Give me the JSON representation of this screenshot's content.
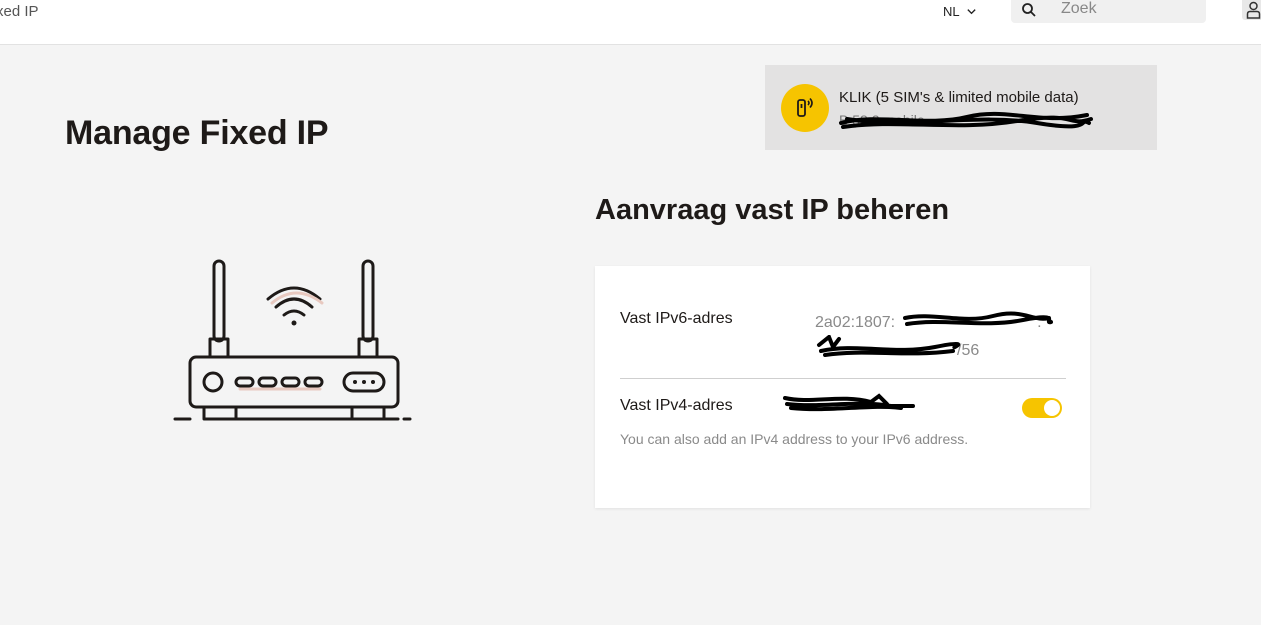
{
  "header": {
    "breadcrumb": "xed IP",
    "language": "NL",
    "search_placeholder": "Zoek"
  },
  "subscription": {
    "title": "KLIK (5 SIM's & limited mobile data)",
    "number_visible": "B                    58  2              mobile"
  },
  "page": {
    "title": "Manage Fixed IP"
  },
  "ip_section": {
    "title": "Aanvraag vast IP beheren",
    "ipv6_label": "Vast IPv6-adres",
    "ipv6_line1": "2a02:1807:",
    "ipv6_line1_end": ":",
    "ipv6_line2_end": "/56",
    "ipv4_label": "Vast IPv4-adres",
    "ipv4_hint": "You can also add an IPv4 address to your IPv6 address.",
    "ipv4_enabled": true
  },
  "colors": {
    "accent": "#f6c400",
    "background": "#f4f4f4",
    "card": "#ffffff",
    "text": "#1e1a18"
  }
}
